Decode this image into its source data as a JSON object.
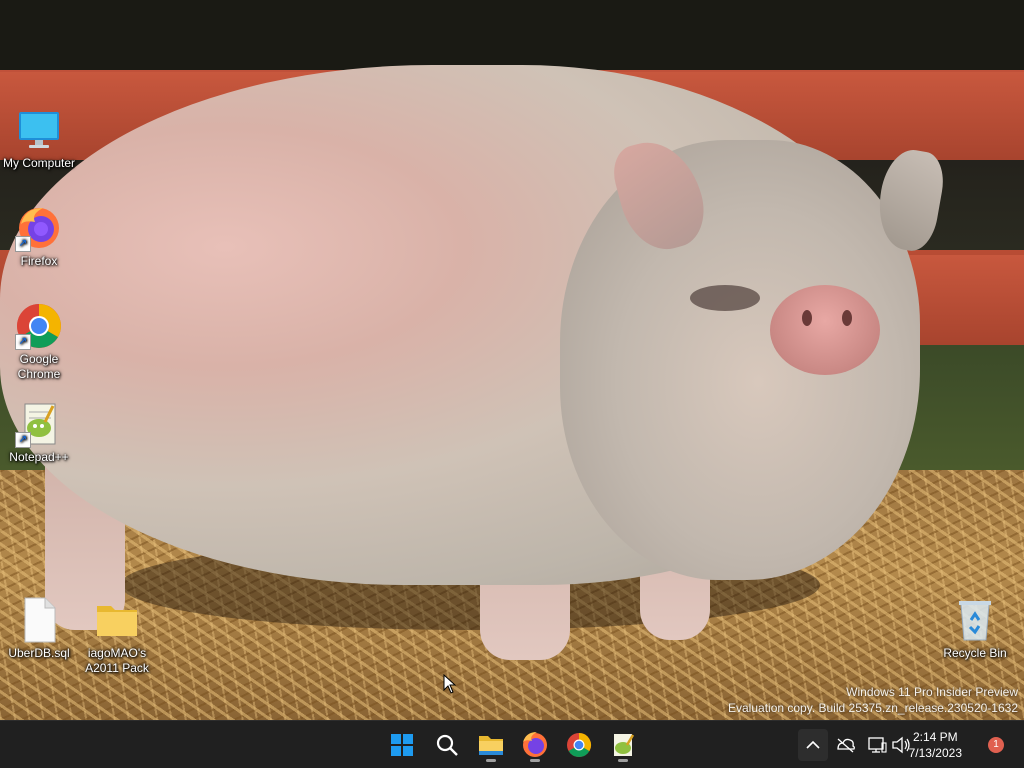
{
  "desktop": {
    "icons": [
      {
        "label": "My Computer"
      },
      {
        "label": "Firefox"
      },
      {
        "label": "Google Chrome"
      },
      {
        "label": "Notepad++"
      },
      {
        "label": "UberDB.sql"
      },
      {
        "label": "iagoMAO's A2011 Pack"
      },
      {
        "label": "Recycle Bin"
      }
    ],
    "watermark": {
      "line1": "Windows 11 Pro Insider Preview",
      "line2": "Evaluation copy. Build 25375.zn_release.230520-1632"
    }
  },
  "taskbar": {
    "pinned": [
      {
        "icon": "windows-start-icon"
      },
      {
        "icon": "search-icon"
      },
      {
        "icon": "file-explorer-icon"
      },
      {
        "icon": "firefox-icon"
      },
      {
        "icon": "chrome-icon"
      },
      {
        "icon": "notepadpp-icon"
      }
    ],
    "clock": {
      "time": "2:14 PM",
      "date": "7/13/2023"
    },
    "notification_count": "1"
  },
  "colors": {
    "taskbar_bg": "#202020",
    "accent": "#0078d4",
    "notification_badge": "#e06050"
  }
}
